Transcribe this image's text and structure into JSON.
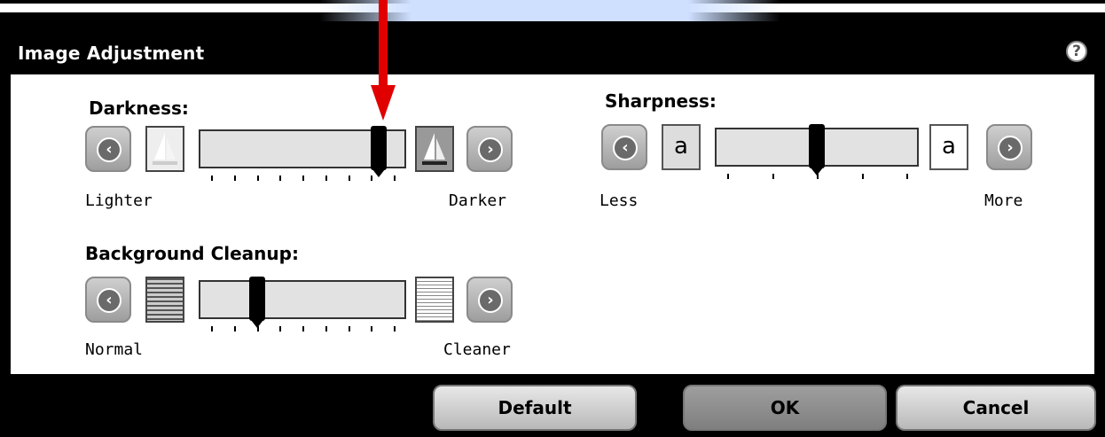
{
  "dialog": {
    "title": "Image Adjustment",
    "help_icon": "help-icon",
    "help_text": "?"
  },
  "darkness": {
    "label": "Darkness:",
    "left_label": "Lighter",
    "right_label": "Darker",
    "level": 0.92
  },
  "sharpness": {
    "label": "Sharpness:",
    "left_label": "Less",
    "right_label": "More",
    "level": 0.5,
    "left_letter": "a",
    "right_letter": "a"
  },
  "background": {
    "label": "Background Cleanup:",
    "left_label": "Normal",
    "right_label": "Cleaner",
    "level": 0.25
  },
  "buttons": {
    "default": "Default",
    "ok": "OK",
    "cancel": "Cancel"
  },
  "colors": {
    "annotation_arrow": "#e00000"
  }
}
